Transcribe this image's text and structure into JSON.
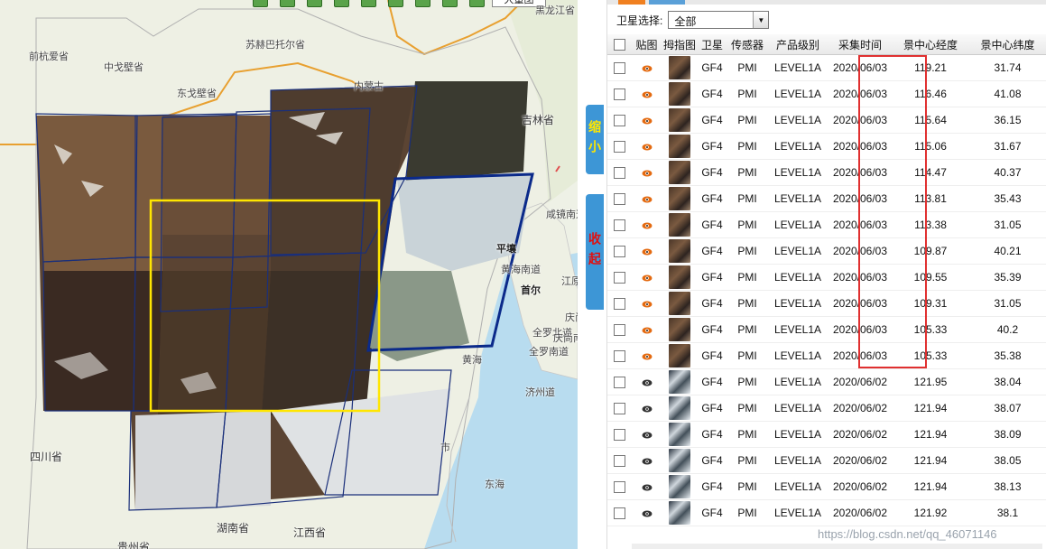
{
  "map": {
    "map_type_button": "大量图",
    "labels": [
      {
        "name": "heilongjiang",
        "text": "黑龙江省"
      },
      {
        "name": "qianhangqi",
        "text": "前杭爱省"
      },
      {
        "name": "suhebatuo",
        "text": "苏赫巴托尔省"
      },
      {
        "name": "zhongge",
        "text": "中戈壁省"
      },
      {
        "name": "dongge",
        "text": "东戈壁省"
      },
      {
        "name": "neimeng",
        "text": "内蒙古"
      },
      {
        "name": "jilin",
        "text": "吉林省"
      },
      {
        "name": "xianjing",
        "text": "咸镜南道"
      },
      {
        "name": "pingrang",
        "text": "平壤"
      },
      {
        "name": "huanghai-nan",
        "text": "黄海南道"
      },
      {
        "name": "shouer",
        "text": "首尔"
      },
      {
        "name": "jiangyuan",
        "text": "江原道"
      },
      {
        "name": "qingbei",
        "text": "庆尚北道"
      },
      {
        "name": "quanluo-bei",
        "text": "全罗北道"
      },
      {
        "name": "quanluo-nan",
        "text": "全罗南道"
      },
      {
        "name": "qingnan",
        "text": "庆尚南道"
      },
      {
        "name": "huanghai",
        "text": "黄海"
      },
      {
        "name": "jizhou",
        "text": "济州道"
      },
      {
        "name": "sichuan",
        "text": "四川省"
      },
      {
        "name": "hunan",
        "text": "湖南省"
      },
      {
        "name": "jiangxi",
        "text": "江西省"
      },
      {
        "name": "guizhou",
        "text": "贵州省"
      },
      {
        "name": "donghai",
        "text": "东海"
      },
      {
        "name": "shi",
        "text": "市"
      }
    ],
    "zoom_tab": "缩小",
    "collapse_tab": "收起"
  },
  "panel": {
    "filter_label": "卫星选择:",
    "filter_value": "全部",
    "columns": [
      "贴图",
      "拇指图",
      "卫星",
      "传感器",
      "产品级别",
      "采集时间",
      "景中心经度",
      "景中心纬度"
    ],
    "rows": [
      {
        "sat": "GF4",
        "sensor": "PMI",
        "level": "LEVEL1A",
        "time": "2020/06/03",
        "lon": "119.21",
        "lat": "31.74",
        "thumb": "brown",
        "eye": "orange"
      },
      {
        "sat": "GF4",
        "sensor": "PMI",
        "level": "LEVEL1A",
        "time": "2020/06/03",
        "lon": "116.46",
        "lat": "41.08",
        "thumb": "brown",
        "eye": "orange"
      },
      {
        "sat": "GF4",
        "sensor": "PMI",
        "level": "LEVEL1A",
        "time": "2020/06/03",
        "lon": "115.64",
        "lat": "36.15",
        "thumb": "brown",
        "eye": "orange"
      },
      {
        "sat": "GF4",
        "sensor": "PMI",
        "level": "LEVEL1A",
        "time": "2020/06/03",
        "lon": "115.06",
        "lat": "31.67",
        "thumb": "brown",
        "eye": "orange"
      },
      {
        "sat": "GF4",
        "sensor": "PMI",
        "level": "LEVEL1A",
        "time": "2020/06/03",
        "lon": "114.47",
        "lat": "40.37",
        "thumb": "brown",
        "eye": "orange"
      },
      {
        "sat": "GF4",
        "sensor": "PMI",
        "level": "LEVEL1A",
        "time": "2020/06/03",
        "lon": "113.81",
        "lat": "35.43",
        "thumb": "brown",
        "eye": "orange"
      },
      {
        "sat": "GF4",
        "sensor": "PMI",
        "level": "LEVEL1A",
        "time": "2020/06/03",
        "lon": "113.38",
        "lat": "31.05",
        "thumb": "brown",
        "eye": "orange"
      },
      {
        "sat": "GF4",
        "sensor": "PMI",
        "level": "LEVEL1A",
        "time": "2020/06/03",
        "lon": "109.87",
        "lat": "40.21",
        "thumb": "brown",
        "eye": "orange"
      },
      {
        "sat": "GF4",
        "sensor": "PMI",
        "level": "LEVEL1A",
        "time": "2020/06/03",
        "lon": "109.55",
        "lat": "35.39",
        "thumb": "brown",
        "eye": "orange"
      },
      {
        "sat": "GF4",
        "sensor": "PMI",
        "level": "LEVEL1A",
        "time": "2020/06/03",
        "lon": "109.31",
        "lat": "31.05",
        "thumb": "brown",
        "eye": "orange"
      },
      {
        "sat": "GF4",
        "sensor": "PMI",
        "level": "LEVEL1A",
        "time": "2020/06/03",
        "lon": "105.33",
        "lat": "40.2",
        "thumb": "brown",
        "eye": "orange"
      },
      {
        "sat": "GF4",
        "sensor": "PMI",
        "level": "LEVEL1A",
        "time": "2020/06/03",
        "lon": "105.33",
        "lat": "35.38",
        "thumb": "brown",
        "eye": "orange"
      },
      {
        "sat": "GF4",
        "sensor": "PMI",
        "level": "LEVEL1A",
        "time": "2020/06/02",
        "lon": "121.95",
        "lat": "38.04",
        "thumb": "cloud",
        "eye": "dark"
      },
      {
        "sat": "GF4",
        "sensor": "PMI",
        "level": "LEVEL1A",
        "time": "2020/06/02",
        "lon": "121.94",
        "lat": "38.07",
        "thumb": "cloud",
        "eye": "dark"
      },
      {
        "sat": "GF4",
        "sensor": "PMI",
        "level": "LEVEL1A",
        "time": "2020/06/02",
        "lon": "121.94",
        "lat": "38.09",
        "thumb": "cloud",
        "eye": "dark"
      },
      {
        "sat": "GF4",
        "sensor": "PMI",
        "level": "LEVEL1A",
        "time": "2020/06/02",
        "lon": "121.94",
        "lat": "38.05",
        "thumb": "cloud",
        "eye": "dark"
      },
      {
        "sat": "GF4",
        "sensor": "PMI",
        "level": "LEVEL1A",
        "time": "2020/06/02",
        "lon": "121.94",
        "lat": "38.13",
        "thumb": "cloud",
        "eye": "dark"
      },
      {
        "sat": "GF4",
        "sensor": "PMI",
        "level": "LEVEL1A",
        "time": "2020/06/02",
        "lon": "121.92",
        "lat": "38.1",
        "thumb": "cloud",
        "eye": "dark"
      }
    ],
    "watermark": "https://blog.csdn.net/qq_46071146"
  },
  "colors": {
    "selected_footprint": "#ffe600",
    "active_footprint": "#0b2a8a",
    "footprint": "#1a2f7a",
    "highlight": "#e03030",
    "eye_orange": "#e46a10",
    "eye_dark": "#333333",
    "tab_bg": "#3d96d6"
  }
}
